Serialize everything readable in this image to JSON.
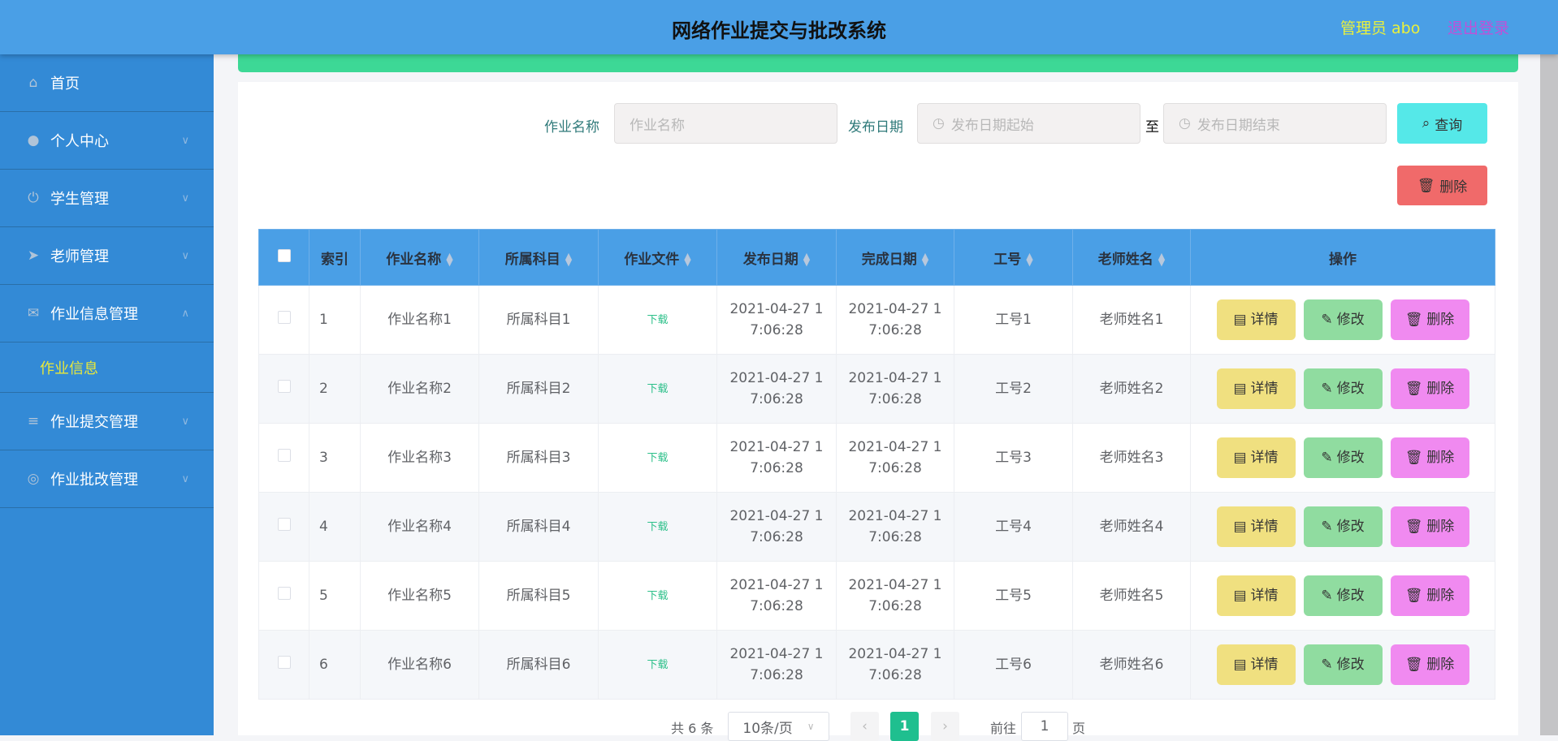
{
  "header": {
    "title": "网络作业提交与批改系统",
    "user": "管理员 abo",
    "logout": "退出登录"
  },
  "sidebar": {
    "items": [
      {
        "label": "首页",
        "icon": "home-icon",
        "glyph": "⌂",
        "chev": ""
      },
      {
        "label": "个人中心",
        "icon": "user-icon",
        "glyph": "●",
        "chev": "∨"
      },
      {
        "label": "学生管理",
        "icon": "power-icon",
        "glyph": "⏻",
        "chev": "∨"
      },
      {
        "label": "老师管理",
        "icon": "send-icon",
        "glyph": "➤",
        "chev": "∨"
      },
      {
        "label": "作业信息管理",
        "icon": "message-icon",
        "glyph": "✉",
        "chev": "∧"
      }
    ],
    "sub": "作业信息",
    "items2": [
      {
        "label": "作业提交管理",
        "icon": "menu-icon",
        "glyph": "≡",
        "chev": "∨"
      },
      {
        "label": "作业批改管理",
        "icon": "compass-icon",
        "glyph": "◎",
        "chev": "∨"
      }
    ]
  },
  "search": {
    "name_label": "作业名称",
    "name_placeholder": "作业名称",
    "date_label": "发布日期",
    "start_placeholder": "发布日期起始",
    "to": "至",
    "end_placeholder": "发布日期结束",
    "query": "查询",
    "delete": "删除"
  },
  "table": {
    "headers": [
      "索引",
      "作业名称",
      "所属科目",
      "作业文件",
      "发布日期",
      "完成日期",
      "工号",
      "老师姓名",
      "操作"
    ],
    "download": "下载",
    "actions": {
      "detail": "详情",
      "edit": "修改",
      "delete": "删除"
    },
    "rows": [
      {
        "idx": "1",
        "name": "作业名称1",
        "subject": "所属科目1",
        "pub": "2021-04-27 17:06:28",
        "done": "2021-04-27 17:06:28",
        "id": "工号1",
        "teacher": "老师姓名1"
      },
      {
        "idx": "2",
        "name": "作业名称2",
        "subject": "所属科目2",
        "pub": "2021-04-27 17:06:28",
        "done": "2021-04-27 17:06:28",
        "id": "工号2",
        "teacher": "老师姓名2"
      },
      {
        "idx": "3",
        "name": "作业名称3",
        "subject": "所属科目3",
        "pub": "2021-04-27 17:06:28",
        "done": "2021-04-27 17:06:28",
        "id": "工号3",
        "teacher": "老师姓名3"
      },
      {
        "idx": "4",
        "name": "作业名称4",
        "subject": "所属科目4",
        "pub": "2021-04-27 17:06:28",
        "done": "2021-04-27 17:06:28",
        "id": "工号4",
        "teacher": "老师姓名4"
      },
      {
        "idx": "5",
        "name": "作业名称5",
        "subject": "所属科目5",
        "pub": "2021-04-27 17:06:28",
        "done": "2021-04-27 17:06:28",
        "id": "工号5",
        "teacher": "老师姓名5"
      },
      {
        "idx": "6",
        "name": "作业名称6",
        "subject": "所属科目6",
        "pub": "2021-04-27 17:06:28",
        "done": "2021-04-27 17:06:28",
        "id": "工号6",
        "teacher": "老师姓名6"
      }
    ]
  },
  "pagination": {
    "total": "共 6 条",
    "page_size": "10条/页",
    "current": "1",
    "goto": "前往",
    "goto_value": "1",
    "page_suffix": "页"
  }
}
